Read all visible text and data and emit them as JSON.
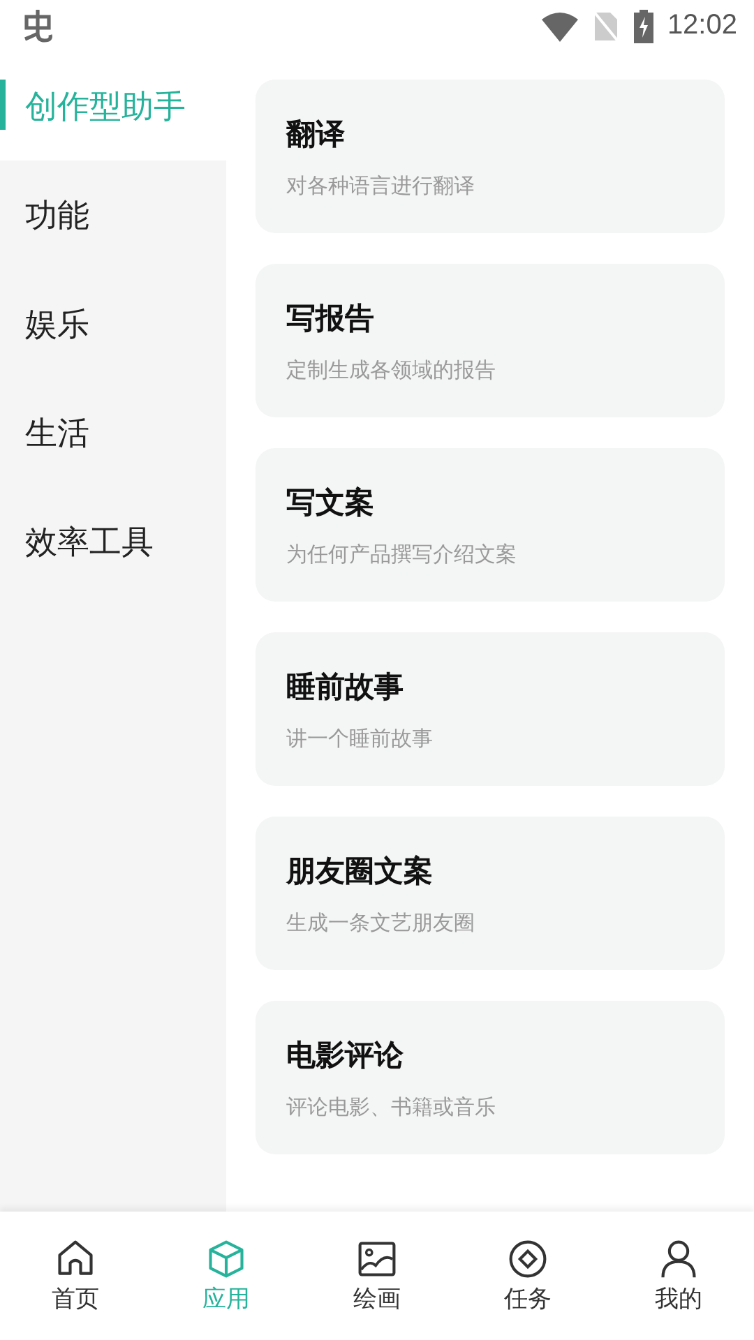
{
  "status_bar": {
    "time": "12:02"
  },
  "sidebar": {
    "items": [
      {
        "label": "创作型助手",
        "selected": true
      },
      {
        "label": "功能",
        "selected": false
      },
      {
        "label": "娱乐",
        "selected": false
      },
      {
        "label": "生活",
        "selected": false
      },
      {
        "label": "效率工具",
        "selected": false
      }
    ]
  },
  "cards": [
    {
      "title": "翻译",
      "subtitle": "对各种语言进行翻译"
    },
    {
      "title": "写报告",
      "subtitle": "定制生成各领域的报告"
    },
    {
      "title": "写文案",
      "subtitle": "为任何产品撰写介绍文案"
    },
    {
      "title": "睡前故事",
      "subtitle": "讲一个睡前故事"
    },
    {
      "title": "朋友圈文案",
      "subtitle": "生成一条文艺朋友圈"
    },
    {
      "title": "电影评论",
      "subtitle": "评论电影、书籍或音乐"
    }
  ],
  "bottom_nav": [
    {
      "kind": "home",
      "label": "首页",
      "selected": false
    },
    {
      "kind": "cube",
      "label": "应用",
      "selected": true
    },
    {
      "kind": "image",
      "label": "绘画",
      "selected": false
    },
    {
      "kind": "task",
      "label": "任务",
      "selected": false
    },
    {
      "kind": "user",
      "label": "我的",
      "selected": false
    }
  ]
}
